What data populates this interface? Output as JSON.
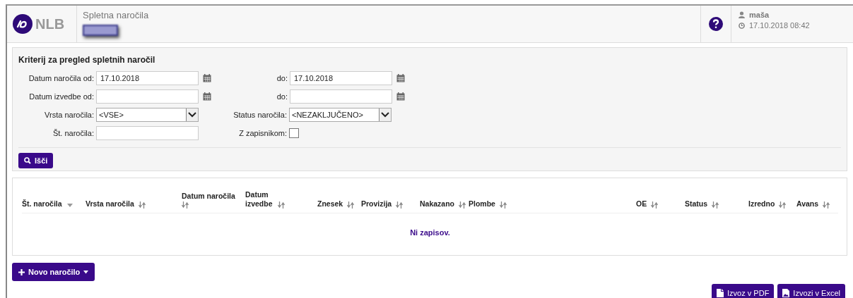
{
  "header": {
    "logo_text": "NLB",
    "app_title": "Spletna naročila",
    "redacted": true,
    "user": "maša",
    "datetime": "17.10.2018 08:42"
  },
  "criteria": {
    "title": "Kriterij za pregled spletnih naročil",
    "rows": [
      {
        "left": {
          "label": "Datum naročila od:",
          "kind": "date",
          "value": "17.10.2018"
        },
        "right": {
          "label": "do:",
          "kind": "date",
          "value": "17.10.2018"
        }
      },
      {
        "left": {
          "label": "Datum izvedbe od:",
          "kind": "date"
        },
        "right": {
          "label": "do:",
          "kind": "date"
        }
      },
      {
        "left": {
          "label": "Vrsta naročila:",
          "kind": "select",
          "value": "<VSE>"
        },
        "right": {
          "label": "Status naročila:",
          "kind": "select",
          "value": "<NEZAKLJUČENO>"
        }
      },
      {
        "left": {
          "label": "Št. naročila:",
          "kind": "text"
        },
        "right": {
          "label": "Z zapisnikom:",
          "kind": "checkbox",
          "checked": false
        }
      }
    ],
    "search_button": "Išči"
  },
  "table": {
    "columns": [
      {
        "label": "Št. naročila",
        "sorted": true
      },
      {
        "label": "Vrsta naročila",
        "sorted": false
      },
      {
        "label": "Datum naročila",
        "sorted": false
      },
      {
        "label": "Datum izvedbe",
        "sorted": false
      },
      {
        "label": "Znesek",
        "sorted": false
      },
      {
        "label": "Provizija",
        "sorted": false
      },
      {
        "label": "Nakazano",
        "sorted": false
      },
      {
        "label": "Plombe",
        "sorted": false
      },
      {
        "label": "OE",
        "sorted": false
      },
      {
        "label": "Status",
        "sorted": false
      },
      {
        "label": "Izredno",
        "sorted": false
      },
      {
        "label": "Avans",
        "sorted": false
      }
    ],
    "empty_message": "Ni zapisov."
  },
  "new_button": "Novo naročilo",
  "export_buttons": [
    {
      "label": "Izvoz v PDF",
      "kind": "pdf"
    },
    {
      "label": "Izvozi v Excel",
      "kind": "excel"
    }
  ]
}
